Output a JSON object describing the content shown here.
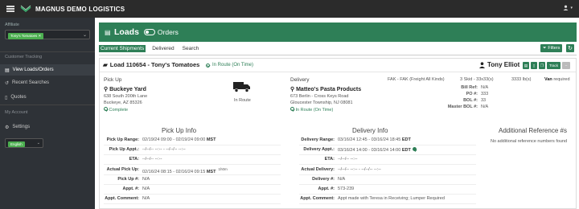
{
  "header": {
    "brand": "MAGNUS DEMO LOGISTICS"
  },
  "sidebar": {
    "affiliate_label": "Affiliate",
    "affiliate_tag": "Tony's Tomatoes",
    "section_customer": "Customer Tracking",
    "items": [
      {
        "label": "View Loads/Orders",
        "active": true
      },
      {
        "label": "Recent Searches"
      },
      {
        "label": "Quotes"
      }
    ],
    "section_account": "My Account",
    "settings_label": "Settings",
    "language": "English"
  },
  "main": {
    "title": "Loads",
    "toggle_label": "Orders",
    "tabs": [
      "Current Shipments",
      "Delivered",
      "Search"
    ],
    "filters_label": "Filters",
    "load": {
      "title": "Load 110654 - Tony's Tomatoes",
      "status": "In Route (On Time)",
      "driver": "Tony Elliot",
      "track_label": "Track",
      "pickup": {
        "heading": "Pick Up",
        "name": "Buckeye Yard",
        "address1": "638 South 200th Lane",
        "address2": "Buckeye, AZ 85326",
        "status": "Complete"
      },
      "transit_label": "In Route",
      "delivery": {
        "heading": "Delivery",
        "name": "Matteo's Pasta Products",
        "address1": "673 Berlin - Cross Keys Road",
        "address2": "Gloucester Township, NJ 08081",
        "status": "In Route (On Time)"
      },
      "freight": "FAK - FAK (Freight All Kinds)",
      "skid": "3 Skid - 33x33(s)",
      "weight": "3333 lb(s)",
      "equipment": "Van",
      "equipment_suffix": "required",
      "refs": [
        {
          "label": "Bill Ref:",
          "value": "N/A"
        },
        {
          "label": "PO #:",
          "value": "333"
        },
        {
          "label": "BOL #:",
          "value": "33"
        },
        {
          "label": "Master BOL #:",
          "value": "N/A"
        }
      ],
      "pickup_info": {
        "heading": "Pick Up Info",
        "rows": [
          {
            "label": "Pick Up Range:",
            "value": "02/19/24 09:00 - 02/19/24 09:00",
            "tz": "MST"
          },
          {
            "label": "Pick Up Appt.:",
            "value": "--/--/-- --:-- - --/--/-- --:--",
            "tz": ""
          },
          {
            "label": "ETA:",
            "value": "--/--/-- --:--",
            "tz": ""
          },
          {
            "label": "Actual Pick Up:",
            "value": "02/16/24 08:15 - 02/16/24 09:15",
            "tz": "MST",
            "extra": "1h0m"
          },
          {
            "label": "Pick Up #:",
            "value": "N/A",
            "tz": ""
          },
          {
            "label": "Appt. #:",
            "value": "N/A",
            "tz": ""
          },
          {
            "label": "Appt. Comment:",
            "value": "N/A",
            "tz": ""
          }
        ]
      },
      "delivery_info": {
        "heading": "Delivery Info",
        "rows": [
          {
            "label": "Delivery Range:",
            "value": "03/16/24 12:45 - 03/16/24 18:45",
            "tz": "EDT"
          },
          {
            "label": "Delivery Appt.:",
            "value": "03/16/24 14:00 - 03/16/24 14:00",
            "tz": "EDT"
          },
          {
            "label": "ETA:",
            "value": "--/--/-- --:--",
            "tz": ""
          },
          {
            "label": "Actual Delivery:",
            "value": "--/--/-- --:-- - --/--/-- --:--",
            "tz": ""
          },
          {
            "label": "Delivery #:",
            "value": "N/A",
            "tz": ""
          },
          {
            "label": "Appt. #:",
            "value": "573-239",
            "tz": ""
          },
          {
            "label": "Appt. Comment:",
            "value": "Appt made with Teresa in Receiving; Lumper Required",
            "tz": ""
          }
        ]
      },
      "additional": {
        "heading": "Additional Reference #s",
        "note": "No additional reference numbers found"
      }
    }
  },
  "colors": {
    "accent": "#2e7f57",
    "topbar": "#2b2b2b",
    "sidebar": "#2e3237"
  }
}
